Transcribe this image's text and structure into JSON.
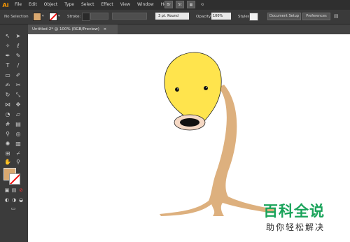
{
  "app": {
    "logo": "Ai"
  },
  "menu": [
    "File",
    "Edit",
    "Object",
    "Type",
    "Select",
    "Effect",
    "View",
    "Window",
    "Help"
  ],
  "menubar_icons": [
    "Br",
    "St",
    "grid-icon",
    "sync-icon"
  ],
  "control": {
    "selection": "No Selection",
    "fill_color": "#d9a870",
    "stroke_label": "Stroke:",
    "brush": "3 pt. Round",
    "opacity_label": "Opacity:",
    "opacity_value": "100%",
    "styles_label": "Styles:",
    "doc_setup": "Document Setup",
    "preferences": "Preferences"
  },
  "document": {
    "tab": "Untitled-2* @ 100% (RGB/Preview)",
    "close": "×"
  },
  "artwork": {
    "head_color": "#ffe44d",
    "body_color": "#ddb07e",
    "mouth_color": "#f5d8c4"
  },
  "watermark": {
    "title": "百科全说",
    "subtitle": "助你轻松解决"
  },
  "tools": [
    "selection-tool",
    "direct-selection-tool",
    "magic-wand-tool",
    "lasso-tool",
    "pen-tool",
    "curvature-tool",
    "type-tool",
    "line-tool",
    "rectangle-tool",
    "paintbrush-tool",
    "shaper-tool",
    "eraser-tool",
    "rotate-tool",
    "scale-tool",
    "width-tool",
    "free-transform-tool",
    "shape-builder-tool",
    "perspective-tool",
    "mesh-tool",
    "gradient-tool",
    "eyedropper-tool",
    "blend-tool",
    "symbol-sprayer-tool",
    "graph-tool",
    "artboard-tool",
    "slice-tool",
    "hand-tool",
    "zoom-tool"
  ]
}
